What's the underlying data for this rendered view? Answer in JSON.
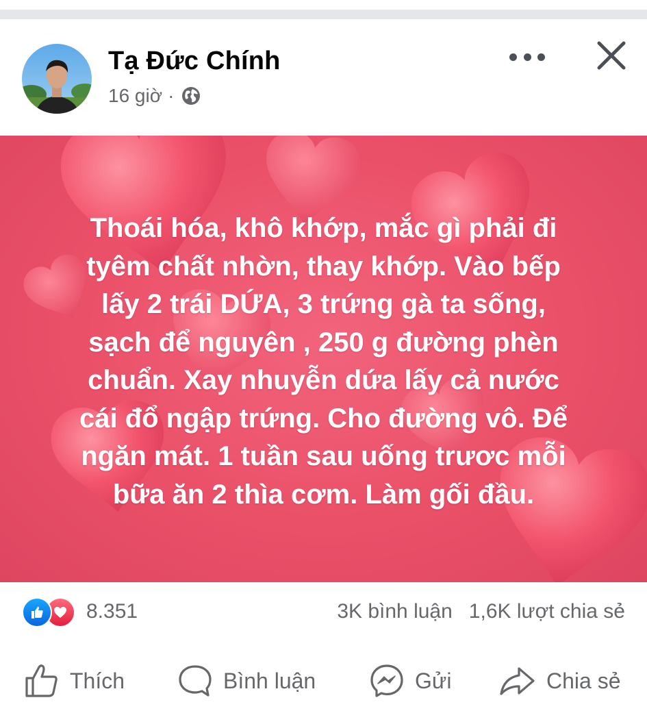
{
  "post": {
    "author_name": "Tạ Đức Chính",
    "time": "16 giờ",
    "separator": "·",
    "privacy_icon": "globe-icon",
    "body_text": "Thoái hóa, khô khớp, mắc gì phải đi\ntyêm chất nhờn, thay khớp. Vào bếp\nlấy 2 trái DỨA, 3 trứng gà ta sống,\nsạch để nguyên , 250 g đường phèn\nchuẩn. Xay nhuyễn dứa lấy cả nước\ncái đổ ngập trứng. Cho đường vô. Để\nngăn mát. 1 tuần sau uống trươc mỗi\nbữa ăn 2 thìa cơm. Làm gối đầu.",
    "background_color": "#ea5068"
  },
  "header": {
    "more_icon": "more-icon",
    "close_icon": "close-icon"
  },
  "reactions": {
    "icons": [
      "like-icon",
      "love-icon"
    ],
    "count": "8.351",
    "comments": "3K bình luận",
    "shares": "1,6K lượt chia sẻ"
  },
  "actions": {
    "like_label": "Thích",
    "comment_label": "Bình luận",
    "send_label": "Gửi",
    "share_label": "Chia sẻ"
  },
  "colors": {
    "like_blue": "#1877f2",
    "love_red": "#e41e3f",
    "secondary_text": "#65676b"
  }
}
